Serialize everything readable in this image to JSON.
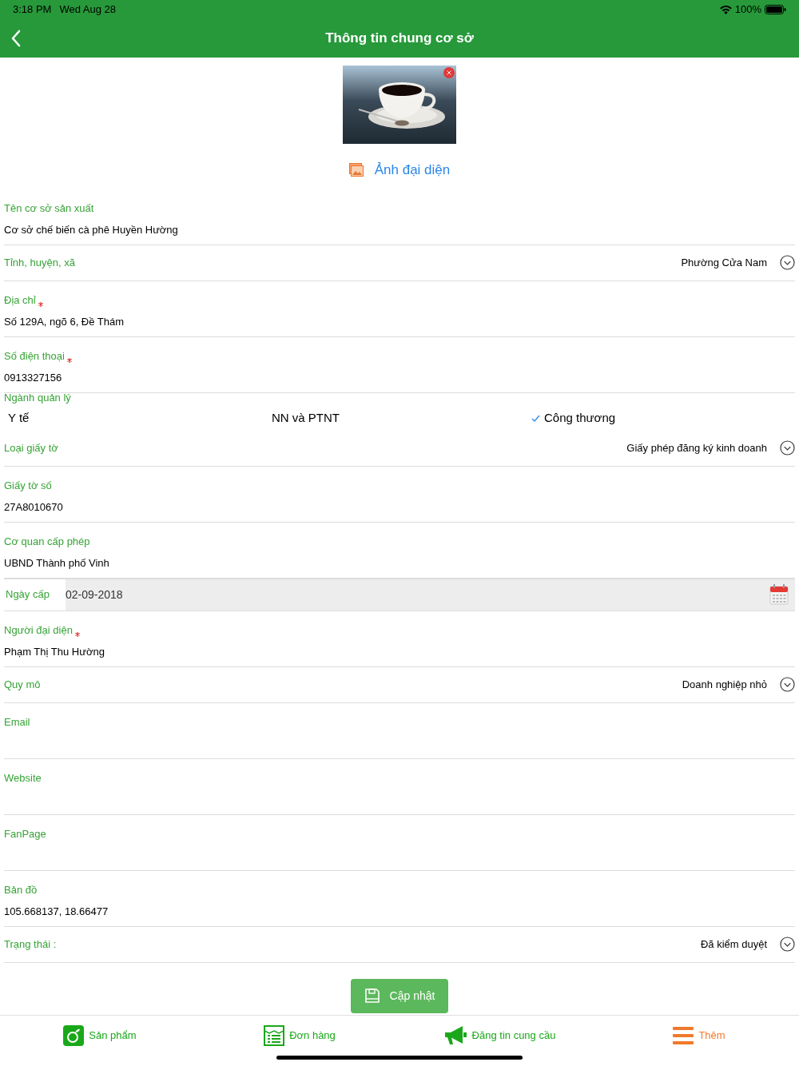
{
  "status_bar": {
    "time": "3:18 PM",
    "date": "Wed Aug 28",
    "battery": "100%"
  },
  "header": {
    "title": "Thông tin chung cơ sở"
  },
  "avatar": {
    "link": "Ảnh đại diện"
  },
  "fields": [
    {
      "kind": "text",
      "label": "Tên cơ sở sản xuất",
      "value": "Cơ sở chế biến cà phê Huyền Hường",
      "required": false
    },
    {
      "kind": "select",
      "label": "Tỉnh, huyện, xã",
      "value": "Phường Cửa Nam"
    },
    {
      "kind": "text",
      "label": "Địa chỉ",
      "value": "Số 129A, ngõ 6, Đề Thám",
      "required": true
    },
    {
      "kind": "text",
      "label": "Số điện thoại",
      "value": "0913327156",
      "required": true
    },
    {
      "kind": "options",
      "label": "Ngành quản lý",
      "options": [
        {
          "label": "Y tế",
          "selected": false
        },
        {
          "label": "NN và PTNT",
          "selected": false
        },
        {
          "label": "Công thương",
          "selected": true
        }
      ]
    },
    {
      "kind": "select",
      "label": "Loại giấy tờ",
      "value": "Giấy phép đăng ký kinh doanh"
    },
    {
      "kind": "text",
      "label": "Giấy tờ số",
      "value": "27A8010670",
      "required": false
    },
    {
      "kind": "text",
      "label": "Cơ quan cấp phép",
      "value": "UBND Thành phố Vinh",
      "required": false
    },
    {
      "kind": "date",
      "label": "Ngày cấp",
      "value": "02-09-2018"
    },
    {
      "kind": "text",
      "label": "Người đại diện",
      "value": "Phạm Thị Thu Hường",
      "required": true
    },
    {
      "kind": "select",
      "label": "Quy mô",
      "value": "Doanh nghiệp nhỏ"
    },
    {
      "kind": "text",
      "label": "Email",
      "required": false
    },
    {
      "kind": "text",
      "label": "Website",
      "required": false
    },
    {
      "kind": "text",
      "label": "FanPage",
      "required": false
    },
    {
      "kind": "text",
      "label": "Bản đồ",
      "value": "105.668137, 18.66477",
      "required": false
    },
    {
      "kind": "select",
      "label": "Trạng thái :",
      "value": "Đã kiểm duyệt"
    }
  ],
  "update_button": "Cập nhật",
  "tab_bar": [
    {
      "kind": "products",
      "label": "Sản phẩm",
      "selected": false
    },
    {
      "kind": "orders",
      "label": "Đơn hàng",
      "selected": false
    },
    {
      "kind": "post",
      "label": "Đăng tin cung cầu",
      "selected": false
    },
    {
      "kind": "more",
      "label": "Thêm",
      "selected": true
    }
  ]
}
